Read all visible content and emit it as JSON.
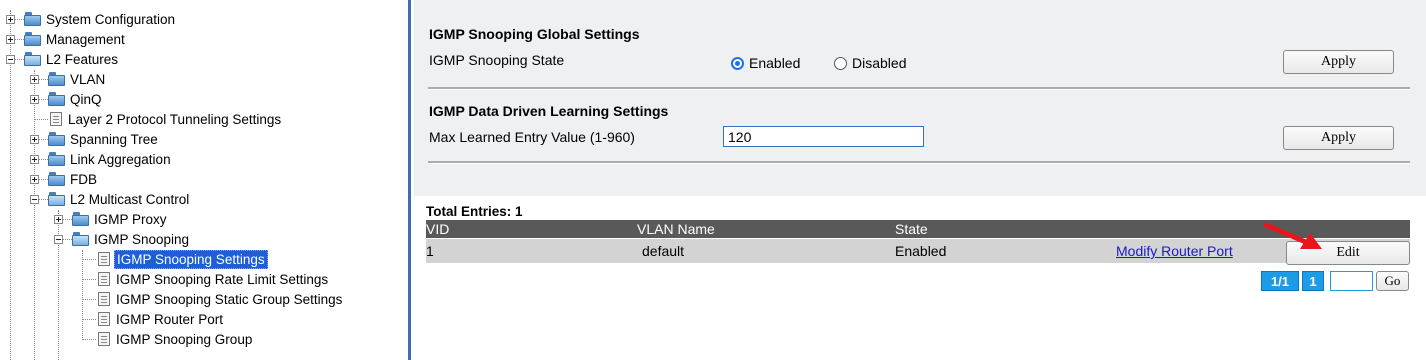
{
  "tree": {
    "items": [
      {
        "label": "System Configuration",
        "icon": "folder-icon"
      },
      {
        "label": "Management",
        "icon": "folder-icon"
      },
      {
        "label": "L2 Features",
        "icon": "folder-open-icon"
      },
      {
        "label": "VLAN",
        "icon": "folder-icon"
      },
      {
        "label": "QinQ",
        "icon": "folder-icon"
      },
      {
        "label": "Layer 2 Protocol Tunneling Settings",
        "icon": "page-icon"
      },
      {
        "label": "Spanning Tree",
        "icon": "folder-icon"
      },
      {
        "label": "Link Aggregation",
        "icon": "folder-icon"
      },
      {
        "label": "FDB",
        "icon": "folder-icon"
      },
      {
        "label": "L2 Multicast Control",
        "icon": "folder-open-icon"
      },
      {
        "label": "IGMP Proxy",
        "icon": "folder-icon"
      },
      {
        "label": "IGMP Snooping",
        "icon": "folder-open-icon"
      },
      {
        "label": "IGMP Snooping Settings",
        "icon": "page-icon",
        "selected": true
      },
      {
        "label": "IGMP Snooping Rate Limit Settings",
        "icon": "page-icon"
      },
      {
        "label": "IGMP Snooping Static Group Settings",
        "icon": "page-icon"
      },
      {
        "label": "IGMP Router Port",
        "icon": "page-icon"
      },
      {
        "label": "IGMP Snooping Group",
        "icon": "page-icon"
      }
    ]
  },
  "global": {
    "title": "IGMP Snooping Global Settings",
    "state_label": "IGMP Snooping State",
    "enabled_label": "Enabled",
    "disabled_label": "Disabled",
    "selected": "Enabled",
    "apply_label": "Apply"
  },
  "learning": {
    "title": "IGMP Data Driven Learning Settings",
    "max_label": "Max Learned Entry Value (1-960)",
    "max_value": "120",
    "apply_label": "Apply"
  },
  "table": {
    "total_entries": "Total Entries: 1",
    "headers": {
      "vid": "VID",
      "vlan_name": "VLAN Name",
      "state": "State"
    },
    "rows": [
      {
        "vid": "1",
        "vlan_name": "default",
        "state": "Enabled",
        "link": "Modify Router Port",
        "edit_label": "Edit"
      }
    ]
  },
  "pager": {
    "pages": "1/1",
    "current": "1",
    "input_value": "",
    "go_label": "Go"
  },
  "colors": {
    "accent": "#1e9be6",
    "selected_bg": "#1c5fd6",
    "header_bg": "#595959",
    "row_bg": "#d3d3d3",
    "annotation_arrow": "#e8161b"
  }
}
